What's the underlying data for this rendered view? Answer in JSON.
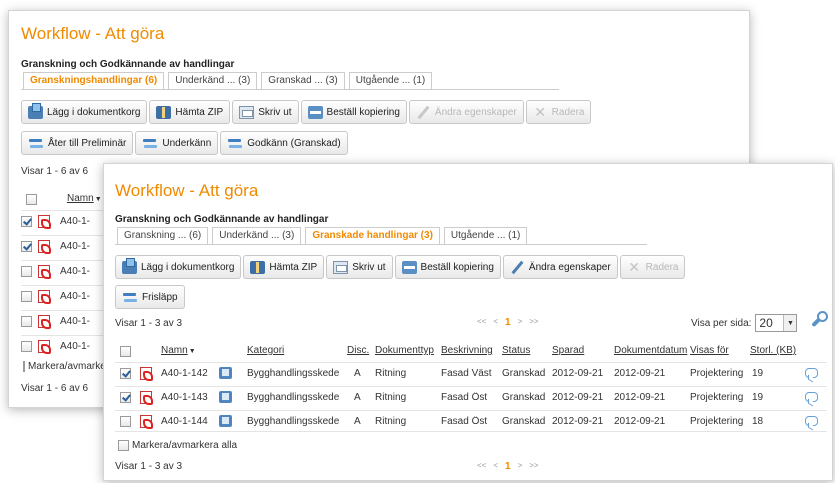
{
  "back_panel": {
    "title": "Workflow - Att göra",
    "subtitle": "Granskning och Godkännande av handlingar",
    "tabs": [
      {
        "label": "Granskningshandlingar (6)",
        "active": true
      },
      {
        "label": "Underkänd ... (3)",
        "active": false
      },
      {
        "label": "Granskad ... (3)",
        "active": false
      },
      {
        "label": "Utgående ... (1)",
        "active": false
      }
    ],
    "toolbar": [
      {
        "label": "Lägg i dokumentkorg",
        "icon": "basket-icon",
        "enabled": true
      },
      {
        "label": "Hämta ZIP",
        "icon": "zip-icon",
        "enabled": true
      },
      {
        "label": "Skriv ut",
        "icon": "print-icon",
        "enabled": true
      },
      {
        "label": "Beställ kopiering",
        "icon": "copy-order-icon",
        "enabled": true
      },
      {
        "label": "Ändra egenskaper",
        "icon": "pencil-icon",
        "enabled": false
      },
      {
        "label": "Radera",
        "icon": "delete-icon",
        "enabled": false
      }
    ],
    "actions": [
      {
        "label": "Åter till Preliminär",
        "icon": "arrows-icon"
      },
      {
        "label": "Underkänn",
        "icon": "arrows-icon"
      },
      {
        "label": "Godkänn (Granskad)",
        "icon": "arrows-icon"
      }
    ],
    "count_top": "Visar 1 - 6 av 6",
    "count_bottom": "Visar 1 - 6 av 6",
    "name_header": "Namn",
    "rows": [
      {
        "name": "A40-1-",
        "checked": true
      },
      {
        "name": "A40-1-",
        "checked": true
      },
      {
        "name": "A40-1-",
        "checked": false
      },
      {
        "name": "A40-1-",
        "checked": false
      },
      {
        "name": "A40-1-",
        "checked": false
      },
      {
        "name": "A40-1-",
        "checked": false
      }
    ],
    "mark_all": "Markera/avmarkera alla"
  },
  "front_panel": {
    "title": "Workflow - Att göra",
    "subtitle": "Granskning och Godkännande av handlingar",
    "tabs": [
      {
        "label": "Granskning ... (6)",
        "active": false
      },
      {
        "label": "Underkänd ... (3)",
        "active": false
      },
      {
        "label": "Granskade handlingar (3)",
        "active": true
      },
      {
        "label": "Utgående ... (1)",
        "active": false
      }
    ],
    "toolbar": [
      {
        "label": "Lägg i dokumentkorg",
        "icon": "basket-icon",
        "enabled": true
      },
      {
        "label": "Hämta ZIP",
        "icon": "zip-icon",
        "enabled": true
      },
      {
        "label": "Skriv ut",
        "icon": "print-icon",
        "enabled": true
      },
      {
        "label": "Beställ kopiering",
        "icon": "copy-order-icon",
        "enabled": true
      },
      {
        "label": "Ändra egenskaper",
        "icon": "pencil-icon",
        "enabled": true
      },
      {
        "label": "Radera",
        "icon": "delete-icon",
        "enabled": false
      }
    ],
    "actions": [
      {
        "label": "Frisläpp",
        "icon": "arrows-icon"
      }
    ],
    "count_top": "Visar 1 - 3 av 3",
    "count_bottom": "Visar 1 - 3 av 3",
    "pager": {
      "first": "<<",
      "prev": "<",
      "current": "1",
      "next": ">",
      "last": ">>"
    },
    "per_page_label": "Visa per sida:",
    "per_page_value": "20",
    "columns": [
      "Namn",
      "Kategori",
      "Disc.",
      "Dokumenttyp",
      "Beskrivning",
      "Status",
      "Sparad",
      "Dokumentdatum",
      "Visas för",
      "Storl. (KB)"
    ],
    "rows": [
      {
        "checked": true,
        "name": "A40-1-142",
        "kategori": "Bygghandlingsskede",
        "disc": "A",
        "typ": "Ritning",
        "beskrivning": "Fasad Väst",
        "status": "Granskad",
        "sparad": "2012-09-21",
        "datum": "2012-09-21",
        "visas": "Projektering",
        "storl": "19"
      },
      {
        "checked": true,
        "name": "A40-1-143",
        "kategori": "Bygghandlingsskede",
        "disc": "A",
        "typ": "Ritning",
        "beskrivning": "Fasad Öst",
        "status": "Granskad",
        "sparad": "2012-09-21",
        "datum": "2012-09-21",
        "visas": "Projektering",
        "storl": "19"
      },
      {
        "checked": false,
        "name": "A40-1-144",
        "kategori": "Bygghandlingsskede",
        "disc": "A",
        "typ": "Ritning",
        "beskrivning": "Fasad Öst",
        "status": "Granskad",
        "sparad": "2012-09-21",
        "datum": "2012-09-21",
        "visas": "Projektering",
        "storl": "18"
      }
    ],
    "mark_all": "Markera/avmarkera alla"
  },
  "colors": {
    "accent": "#f08a00",
    "link_blue": "#4c7fb0",
    "border": "#cccccc"
  }
}
